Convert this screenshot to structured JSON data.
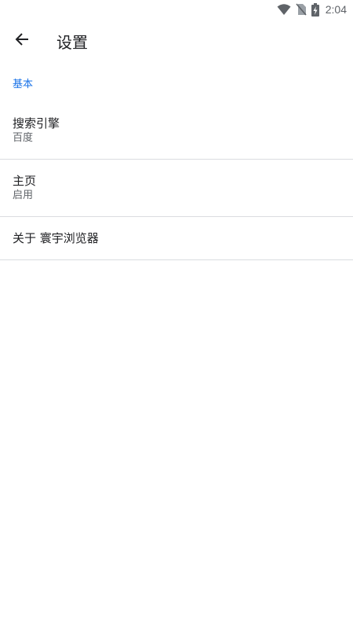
{
  "status_bar": {
    "time": "2:04",
    "icons": [
      "wifi-icon",
      "no-sim-icon",
      "battery-charging-icon"
    ]
  },
  "app_bar": {
    "back_icon": "arrow-back-icon",
    "title": "设置"
  },
  "sections": [
    {
      "header": "基本",
      "items": [
        {
          "title": "搜索引擎",
          "summary": "百度"
        },
        {
          "title": "主页",
          "summary": "启用"
        },
        {
          "title": "关于 寰宇浏览器"
        }
      ]
    }
  ],
  "colors": {
    "accent": "#1a73e8",
    "divider": "#dadce0",
    "text_primary": "#202124",
    "text_secondary": "#5f6368"
  }
}
